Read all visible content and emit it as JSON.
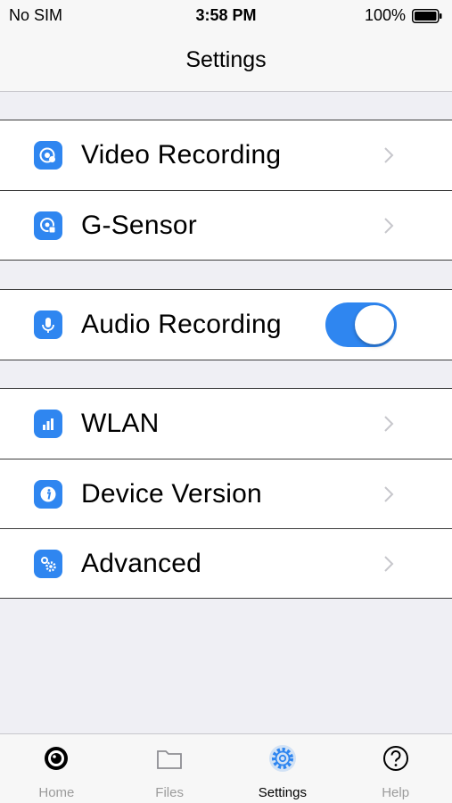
{
  "status_bar": {
    "carrier": "No SIM",
    "time": "3:58 PM",
    "battery": "100%"
  },
  "nav": {
    "title": "Settings"
  },
  "groups": [
    {
      "rows": [
        {
          "label": "Video Recording",
          "icon": "video-recording-icon",
          "accessory": "chevron"
        },
        {
          "label": "G-Sensor",
          "icon": "g-sensor-icon",
          "accessory": "chevron"
        }
      ]
    },
    {
      "rows": [
        {
          "label": "Audio Recording",
          "icon": "microphone-icon",
          "accessory": "toggle",
          "toggle_on": true
        }
      ]
    },
    {
      "rows": [
        {
          "label": "WLAN",
          "icon": "signal-bars-icon",
          "accessory": "chevron"
        },
        {
          "label": "Device Version",
          "icon": "info-icon",
          "accessory": "chevron"
        },
        {
          "label": "Advanced",
          "icon": "gears-icon",
          "accessory": "chevron"
        }
      ]
    }
  ],
  "tab_bar": {
    "tabs": [
      {
        "label": "Home",
        "icon": "camera-lens-icon",
        "active": false
      },
      {
        "label": "Files",
        "icon": "folder-icon",
        "active": false
      },
      {
        "label": "Settings",
        "icon": "gear-icon",
        "active": true
      },
      {
        "label": "Help",
        "icon": "question-icon",
        "active": false
      }
    ]
  },
  "colors": {
    "accent": "#2f86f0",
    "background": "#efeff4",
    "inactive_tab": "#9b9b9b"
  }
}
